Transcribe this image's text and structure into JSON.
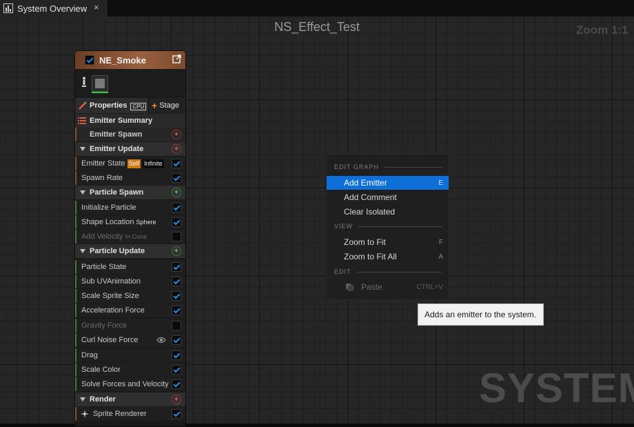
{
  "tab": {
    "title": "System Overview",
    "close": "×",
    "icon": "graph-icon"
  },
  "graph": {
    "title": "NS_Effect_Test",
    "zoom": "Zoom 1:1",
    "watermark": "SYSTEM"
  },
  "node": {
    "title": "NE_Smoke",
    "header_color": "#9a6040",
    "properties_label": "Properties",
    "cpu_label": "CPU",
    "stage_label": "Stage",
    "stage_plus": "+",
    "emitter_summary_label": "Emitter Summary",
    "rows": [
      {
        "type": "item",
        "label": "Emitter Spawn",
        "bold": true,
        "action": "add-red",
        "strip": "#8a5030"
      },
      {
        "type": "section",
        "label": "Emitter Update",
        "action": "add-red"
      },
      {
        "type": "item",
        "label": "Emitter State",
        "badges": [
          "Self",
          "Infinite"
        ],
        "checked": true,
        "strip": "#8a5030"
      },
      {
        "type": "item",
        "label": "Spawn Rate",
        "checked": true,
        "strip": "#8a5030"
      },
      {
        "type": "section",
        "label": "Particle Spawn",
        "action": "add-green"
      },
      {
        "type": "item",
        "label": "Initialize Particle",
        "checked": true,
        "strip": "#4a7a30"
      },
      {
        "type": "item",
        "label": "Shape Location",
        "tag": "Sphere",
        "checked": true,
        "strip": "#4a7a30"
      },
      {
        "type": "item",
        "label": "Add Velocity",
        "tag": "In Cone",
        "checked": false,
        "disabled": true,
        "strip": "#4a7a30"
      },
      {
        "type": "section",
        "label": "Particle Update",
        "action": "add-green"
      },
      {
        "type": "item",
        "label": "Particle State",
        "checked": true,
        "strip": "#4a7a30"
      },
      {
        "type": "item",
        "label": "Sub UVAnimation",
        "checked": true,
        "strip": "#4a7a30"
      },
      {
        "type": "item",
        "label": "Scale Sprite Size",
        "checked": true,
        "strip": "#4a7a30"
      },
      {
        "type": "item",
        "label": "Acceleration Force",
        "checked": true,
        "strip": "#4a7a30"
      },
      {
        "type": "item",
        "label": "Gravity Force",
        "checked": false,
        "disabled": true,
        "strip": "#4a7a30"
      },
      {
        "type": "item",
        "label": "Curl Noise Force",
        "checked": true,
        "eye": true,
        "strip": "#4a7a30"
      },
      {
        "type": "item",
        "label": "Drag",
        "checked": true,
        "strip": "#4a7a30"
      },
      {
        "type": "item",
        "label": "Scale Color",
        "checked": true,
        "strip": "#4a7a30"
      },
      {
        "type": "item",
        "label": "Solve Forces and Velocity",
        "checked": true,
        "strip": "#4a7a30"
      },
      {
        "type": "section",
        "label": "Render",
        "action": "add-red"
      },
      {
        "type": "item",
        "label": "Sprite Renderer",
        "checked": true,
        "strip": "#8a5030",
        "icon": "sprite-icon"
      }
    ]
  },
  "menu": {
    "sections": [
      {
        "label": "EDIT GRAPH",
        "items": [
          {
            "label": "Add Emitter",
            "key": "E",
            "selected": true
          },
          {
            "label": "Add Comment",
            "key": ""
          },
          {
            "label": "Clear Isolated",
            "key": ""
          }
        ]
      },
      {
        "label": "VIEW",
        "items": [
          {
            "label": "Zoom to Fit",
            "key": "F"
          },
          {
            "label": "Zoom to Fit All",
            "key": "A"
          }
        ]
      },
      {
        "label": "EDIT",
        "items": [
          {
            "label": "Paste",
            "key": "CTRL+V",
            "disabled": true,
            "icon": "paste-icon"
          }
        ]
      }
    ]
  },
  "tooltip": "Adds an emitter to the system.",
  "colors": {
    "accent": "#0e6fd8",
    "check": "#2a8be6",
    "stage_plus": "#f08a2c",
    "thumb_underline": "#2ecc40"
  }
}
